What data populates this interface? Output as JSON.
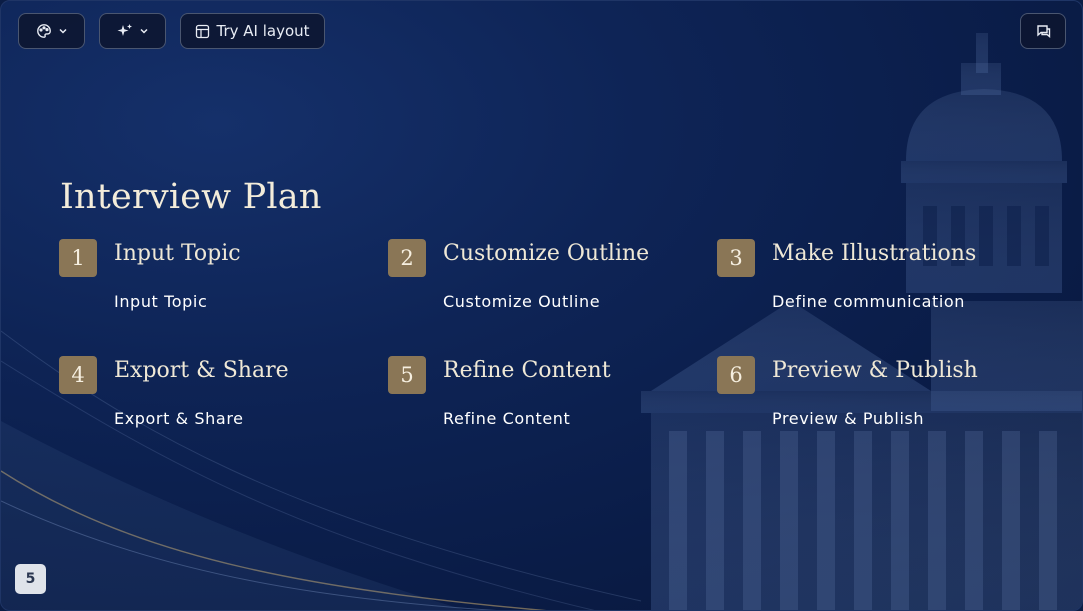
{
  "toolbar": {
    "theme_icon": "palette-icon",
    "ai_icon": "sparkles-icon",
    "layout_icon": "layout-icon",
    "layout_label": "Try AI layout",
    "chat_icon": "chat-icon",
    "chevron_icon": "chevron-down-icon"
  },
  "slide": {
    "title": "Interview Plan",
    "steps": [
      {
        "number": "1",
        "title": "Input Topic",
        "description": "Input Topic"
      },
      {
        "number": "2",
        "title": "Customize Outline",
        "description": "Customize Outline"
      },
      {
        "number": "3",
        "title": "Make Illustrations",
        "description": "Define communication"
      },
      {
        "number": "4",
        "title": "Export & Share",
        "description": "Export & Share"
      },
      {
        "number": "5",
        "title": "Refine Content",
        "description": "Refine Content"
      },
      {
        "number": "6",
        "title": "Preview & Publish",
        "description": "Preview & Publish"
      }
    ],
    "page_number": "5"
  },
  "colors": {
    "background": "#0b1d45",
    "accent_gold": "#8a7656",
    "title_cream": "#f3ecda"
  }
}
